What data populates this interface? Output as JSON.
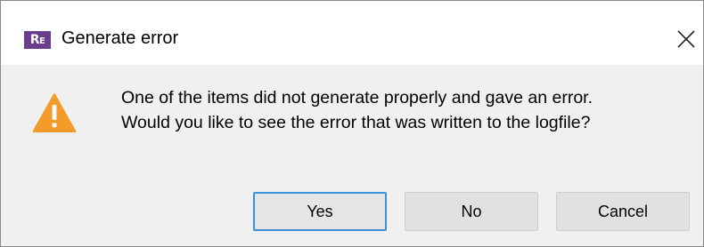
{
  "window": {
    "title": "Generate error",
    "app_icon": "RE",
    "close_icon": "close-icon"
  },
  "content": {
    "icon": "warning-icon",
    "message_line1": "One of the items did not generate properly and gave an error.",
    "message_line2": "Would you like to see the error that was written to the logfile?"
  },
  "buttons": {
    "yes": "Yes",
    "no": "No",
    "cancel": "Cancel",
    "default": "yes"
  },
  "colors": {
    "app_icon_bg": "#6b3d8f",
    "warning": "#f39c2b",
    "focus_border": "#3c8fd9"
  }
}
